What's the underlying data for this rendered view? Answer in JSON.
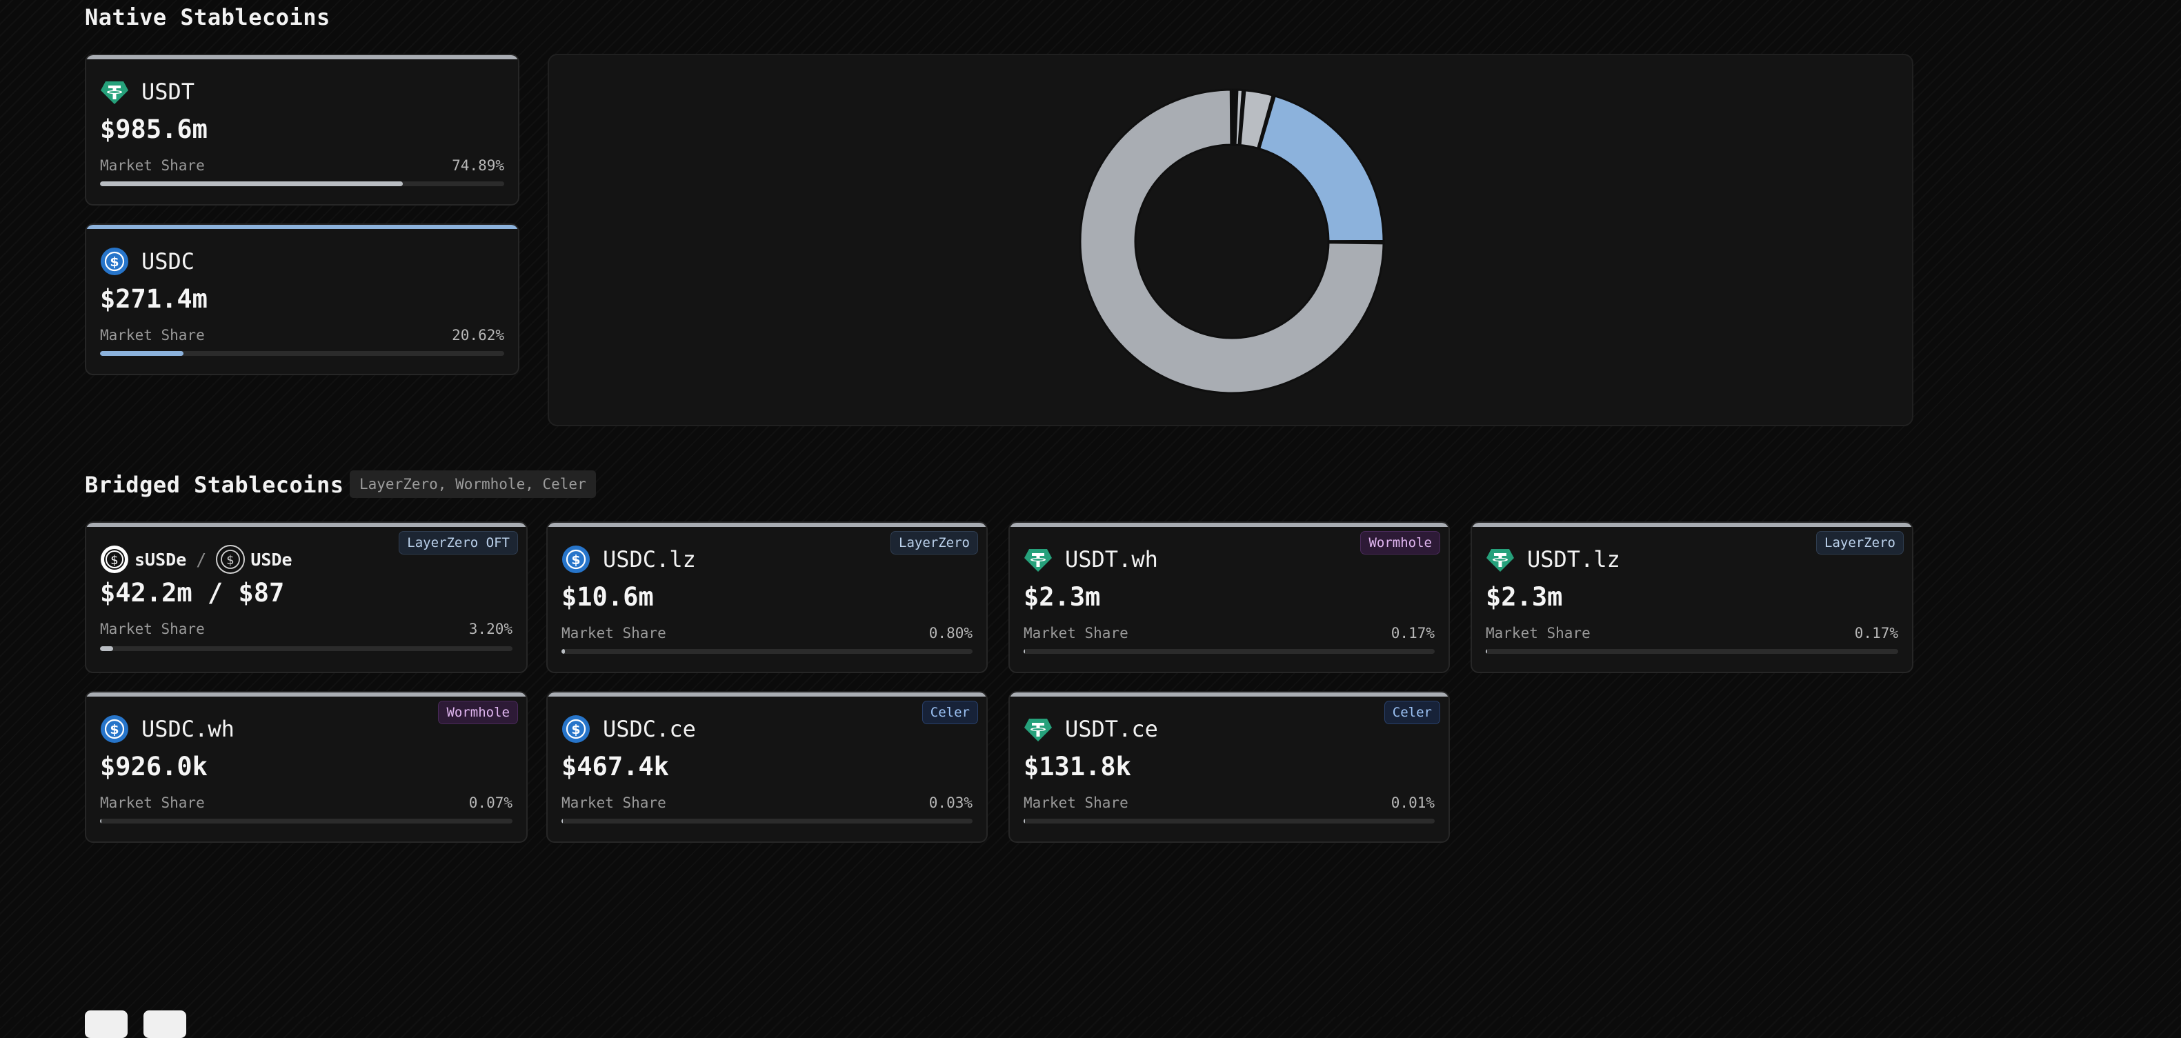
{
  "native": {
    "title": "Native Stablecoins",
    "cards": [
      {
        "name": "USDT",
        "icon": "tether-icon",
        "amount": "$985.6m",
        "share_label": "Market Share",
        "share": "74.89%",
        "share_value": 74.89,
        "color": "#b9bdc2"
      },
      {
        "name": "USDC",
        "icon": "usdc-icon",
        "amount": "$271.4m",
        "share_label": "Market Share",
        "share": "20.62%",
        "share_value": 20.62,
        "color": "#8cb2dc"
      }
    ]
  },
  "bridged": {
    "title": "Bridged Stablecoins",
    "protocols": "LayerZero, Wormhole, Celer",
    "pair_card": {
      "name_a": "sUSDe",
      "separator": "/",
      "name_b": "USDe",
      "badge": "LayerZero OFT",
      "amount": "$42.2m / $87",
      "share_label": "Market Share",
      "share": "3.20%",
      "share_value": 3.2
    },
    "cards": [
      {
        "name": "USDC.lz",
        "icon": "usdc-icon",
        "badge": "LayerZero",
        "badge_type": "lz",
        "amount": "$10.6m",
        "share_label": "Market Share",
        "share": "0.80%",
        "share_value": 0.8
      },
      {
        "name": "USDT.wh",
        "icon": "tether-icon",
        "badge": "Wormhole",
        "badge_type": "wh",
        "amount": "$2.3m",
        "share_label": "Market Share",
        "share": "0.17%",
        "share_value": 0.17
      },
      {
        "name": "USDT.lz",
        "icon": "tether-icon",
        "badge": "LayerZero",
        "badge_type": "lz",
        "amount": "$2.3m",
        "share_label": "Market Share",
        "share": "0.17%",
        "share_value": 0.17
      },
      {
        "name": "USDC.wh",
        "icon": "usdc-icon",
        "badge": "Wormhole",
        "badge_type": "wh",
        "amount": "$926.0k",
        "share_label": "Market Share",
        "share": "0.07%",
        "share_value": 0.07
      },
      {
        "name": "USDC.ce",
        "icon": "usdc-icon",
        "badge": "Celer",
        "badge_type": "ce",
        "amount": "$467.4k",
        "share_label": "Market Share",
        "share": "0.03%",
        "share_value": 0.03
      },
      {
        "name": "USDT.ce",
        "icon": "tether-icon",
        "badge": "Celer",
        "badge_type": "ce",
        "amount": "$131.8k",
        "share_label": "Market Share",
        "share": "0.01%",
        "share_value": 0.01
      }
    ]
  },
  "chart_data": {
    "type": "pie",
    "variant": "donut",
    "categories": [
      "USDT",
      "USDC",
      "sUSDe",
      "USDC.lz",
      "USDT.wh",
      "USDT.lz",
      "USDC.wh",
      "USDC.ce",
      "USDT.ce"
    ],
    "values": [
      74.89,
      20.62,
      3.2,
      0.8,
      0.17,
      0.17,
      0.07,
      0.03,
      0.01
    ],
    "colors": [
      "#a9adb3",
      "#8cb2dc",
      "#b9bdc2",
      "#b9bdc2",
      "#b9bdc2",
      "#b9bdc2",
      "#b9bdc2",
      "#b9bdc2",
      "#b9bdc2"
    ],
    "title": "",
    "legend": "none"
  },
  "colors": {
    "tether": "#26a17b",
    "usdc": "#2775ca",
    "accent_gray": "#a9adb3",
    "accent_blue": "#8cb2dc"
  }
}
